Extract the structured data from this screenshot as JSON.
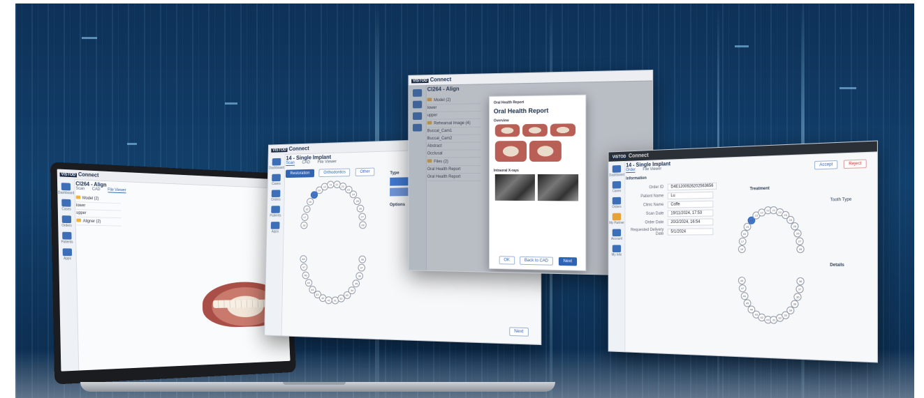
{
  "brand": {
    "prefix": "VISTOD",
    "name": "Connect"
  },
  "laptop_app": {
    "case_title": "Cl264 - Align",
    "tabs": [
      "Scan",
      "CAD",
      "File Viewer"
    ],
    "sidebar": [
      "Dashboard",
      "Cases",
      "Orders",
      "Patients",
      "Apps"
    ],
    "files": [
      "Model (2)",
      "lower",
      "upper",
      "Aligner (2)"
    ]
  },
  "implant_app": {
    "case_title": "14 - Single Implant",
    "tabs": [
      "Scan",
      "CAD",
      "File Viewer"
    ],
    "sidebar": [
      "Dashboard",
      "Cases",
      "Orders",
      "Patients",
      "Apps"
    ],
    "treatment_buttons": [
      "Restoration",
      "Orthodontics",
      "Other"
    ],
    "type_label": "Type",
    "options_label": "Options",
    "next_label": "Next"
  },
  "report_app": {
    "case_title": "Cl264 - Align",
    "modal_header": "Oral Health Report",
    "modal_title": "Oral Health Report",
    "overview_label": "Overview",
    "xray_label": "Intraoral X-rays",
    "folders": [
      "Model (2)",
      "lower",
      "upper",
      "Rehearsal Image (4)",
      "Buccal_Cam1",
      "Buccal_Cam2",
      "Abstract",
      "Occlusal",
      "Files (2)",
      "Oral Health Report",
      "Oral Health Report"
    ],
    "footer": [
      "OK",
      "Back to CAD",
      "Next"
    ]
  },
  "order_app": {
    "case_title": "14 - Single Implant",
    "tabs": [
      "Order",
      "File Viewer"
    ],
    "section": "Information",
    "treatment_label": "Treatment",
    "tooth_type_label": "Tooth Type",
    "sidebar": [
      "Dashboard",
      "Cases",
      "Orders",
      "My Partner",
      "Account",
      "My Info"
    ],
    "fields": [
      {
        "label": "Order ID",
        "value": "D4E1200926202563656"
      },
      {
        "label": "Patient Name",
        "value": "Lu"
      },
      {
        "label": "Clinic Name",
        "value": "Coffe"
      },
      {
        "label": "Scan Date",
        "value": "19/11/2024, 17:53"
      },
      {
        "label": "Order Date",
        "value": "20/2/2024, 16:54"
      },
      {
        "label": "Requested Delivery Date",
        "value": "5/1/2024"
      }
    ],
    "details_label": "Details",
    "actions": [
      "Accept",
      "Reject"
    ]
  },
  "colors": {
    "accent": "#2f63b3",
    "background": "#0f3358"
  }
}
